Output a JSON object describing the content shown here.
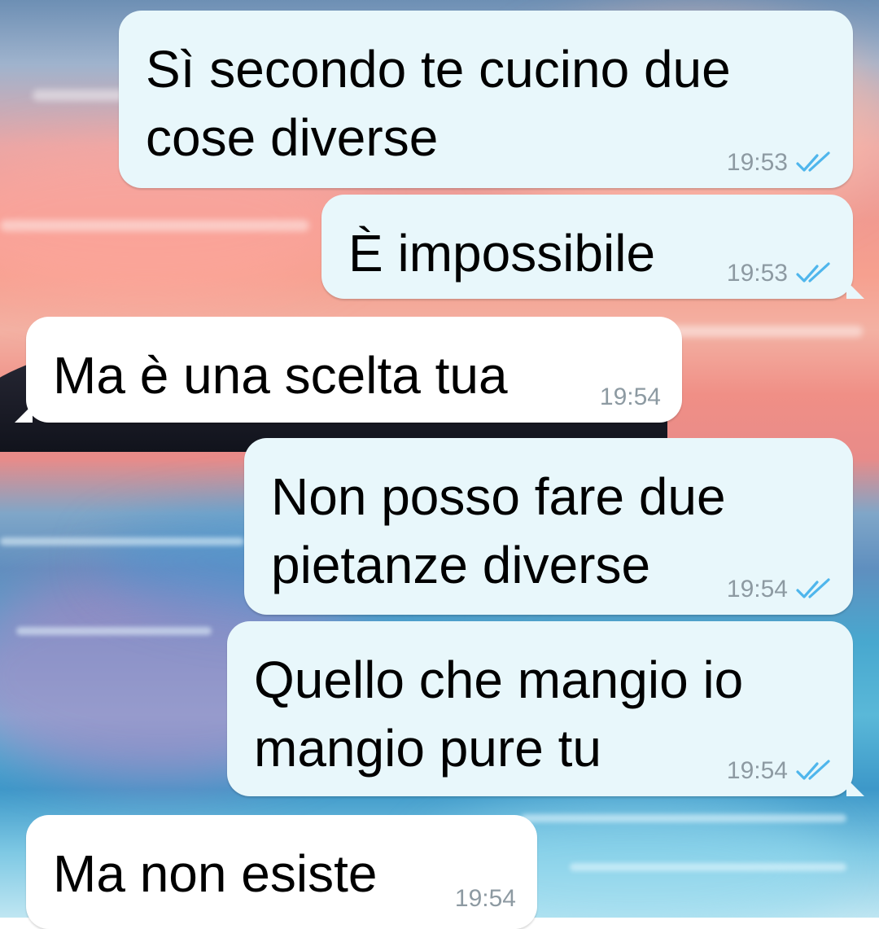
{
  "chat": {
    "messages": [
      {
        "text": "Sì secondo te cucino due\ncose diverse",
        "time": "19:53",
        "direction": "outgoing",
        "status_icon": "double-check-read-icon"
      },
      {
        "text": "È impossibile",
        "time": "19:53",
        "direction": "outgoing",
        "status_icon": "double-check-read-icon"
      },
      {
        "text": "Ma è una scelta tua",
        "time": "19:54",
        "direction": "incoming"
      },
      {
        "text": "Non posso fare due\npietanze diverse",
        "time": "19:54",
        "direction": "outgoing",
        "status_icon": "double-check-read-icon"
      },
      {
        "text": "Quello che mangio io\nmangio pure tu",
        "time": "19:54",
        "direction": "outgoing",
        "status_icon": "double-check-read-icon"
      },
      {
        "text": "Ma non esiste",
        "time": "19:54",
        "direction": "incoming"
      }
    ]
  },
  "colors": {
    "outgoing_bubble": "#e8f7fb",
    "incoming_bubble": "#ffffff",
    "read_tick": "#4fb6ec",
    "timestamp": "#8d9aa2"
  }
}
